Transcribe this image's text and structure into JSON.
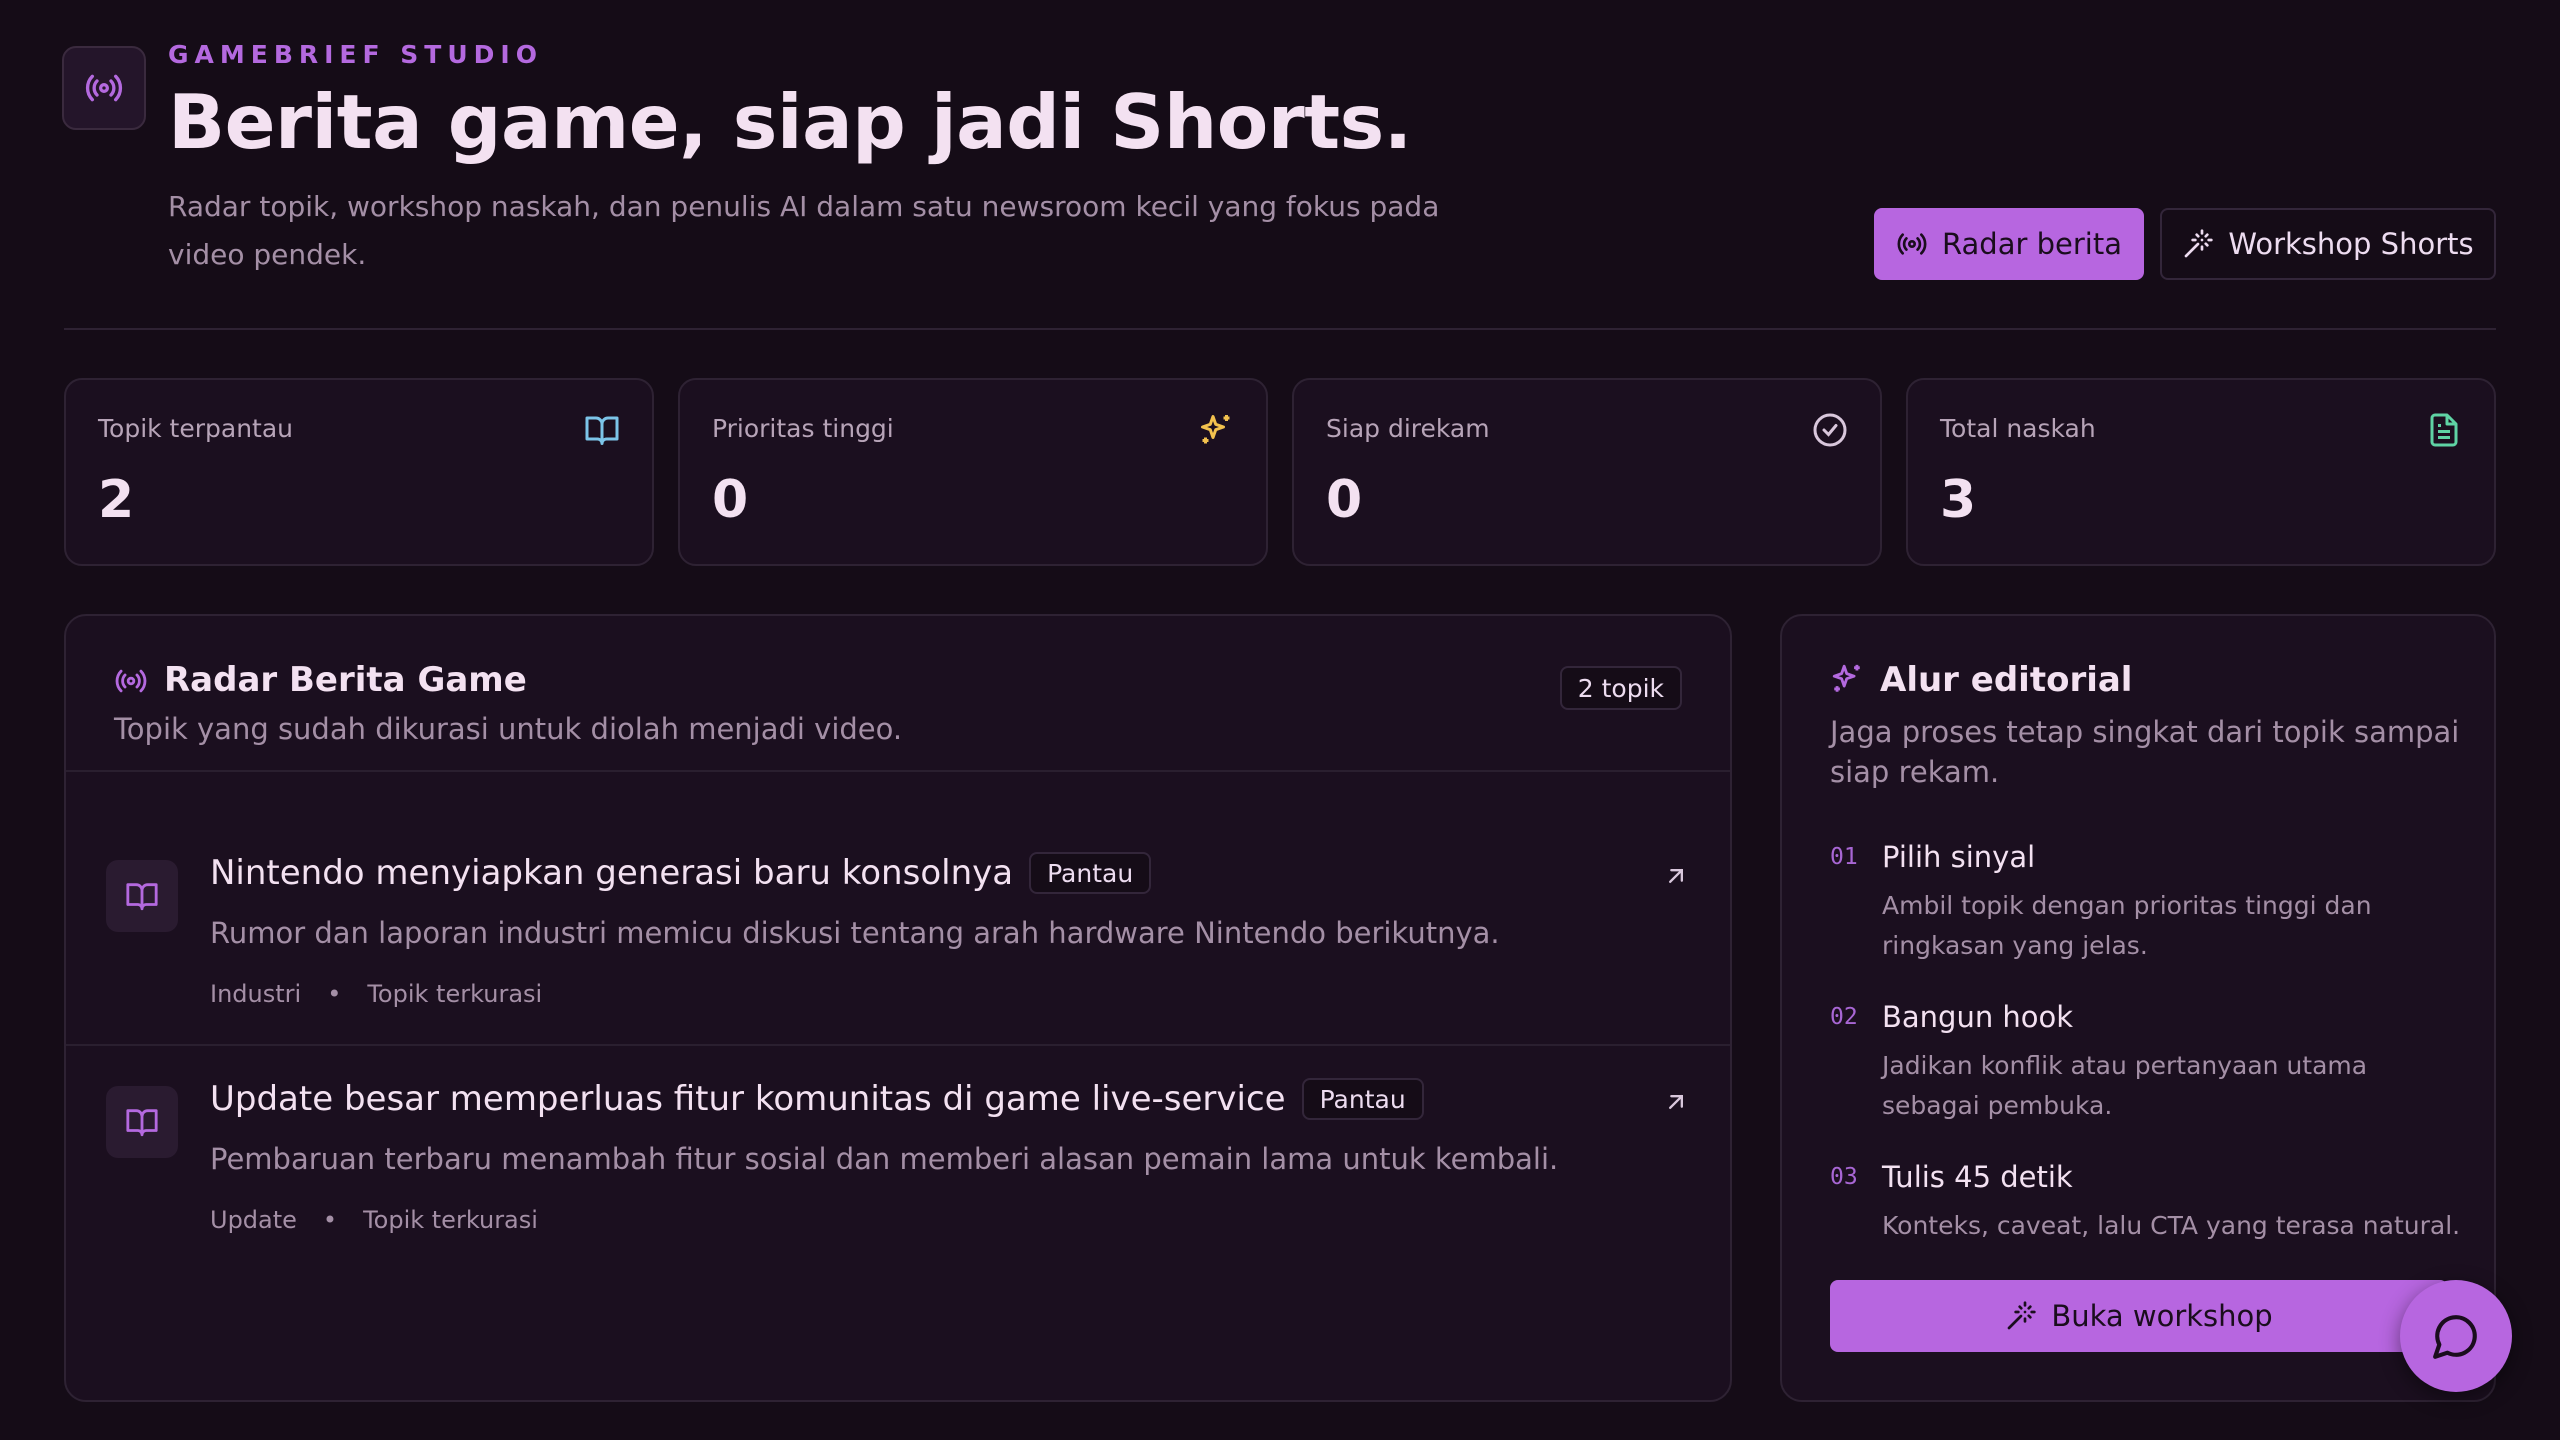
{
  "header": {
    "eyebrow": "GAMEBRIEF STUDIO",
    "title": "Berita game, siap jadi Shorts.",
    "subtitle": "Radar topik, workshop naskah, dan penulis AI dalam satu newsroom kecil yang fokus pada video pendek.",
    "logo_icon": "broadcast-icon",
    "buttons": {
      "radar_label": "Radar berita",
      "workshop_label": "Workshop Shorts"
    }
  },
  "stats": [
    {
      "label": "Topik terpantau",
      "value": "2",
      "icon": "book-open-icon",
      "color": "#7cc4e8"
    },
    {
      "label": "Prioritas tinggi",
      "value": "0",
      "icon": "sparkles-icon",
      "color": "#f2c14e"
    },
    {
      "label": "Siap direkam",
      "value": "0",
      "icon": "check-circle-icon",
      "color": "#d9c7dc"
    },
    {
      "label": "Total naskah",
      "value": "3",
      "icon": "file-text-icon",
      "color": "#5fd3a4"
    }
  ],
  "radar": {
    "title": "Radar Berita Game",
    "description": "Topik yang sudah dikurasi untuk diolah menjadi video.",
    "count_badge": "2 topik",
    "items": [
      {
        "title": "Nintendo menyiapkan generasi baru konsolnya",
        "status": "Pantau",
        "summary": "Rumor dan laporan industri memicu diskusi tentang arah hardware Nintendo berikutnya.",
        "category": "Industri",
        "source": "Topik terkurasi"
      },
      {
        "title": "Update besar memperluas fitur komunitas di game live-service",
        "status": "Pantau",
        "summary": "Pembaruan terbaru menambah fitur sosial dan memberi alasan pemain lama untuk kembali.",
        "category": "Update",
        "source": "Topik terkurasi"
      }
    ]
  },
  "editorial": {
    "title": "Alur editorial",
    "description": "Jaga proses tetap singkat dari topik sampai siap rekam.",
    "steps": [
      {
        "num": "01",
        "title": "Pilih sinyal",
        "desc": "Ambil topik dengan prioritas tinggi dan ringkasan yang jelas."
      },
      {
        "num": "02",
        "title": "Bangun hook",
        "desc": "Jadikan konflik atau pertanyaan utama sebagai pembuka."
      },
      {
        "num": "03",
        "title": "Tulis 45 detik",
        "desc": "Konteks, caveat, lalu CTA yang terasa natural."
      }
    ],
    "button_label": "Buka workshop"
  },
  "colors": {
    "accent": "#b766e0",
    "background": "#150c17",
    "panel": "#1b0f1f"
  }
}
